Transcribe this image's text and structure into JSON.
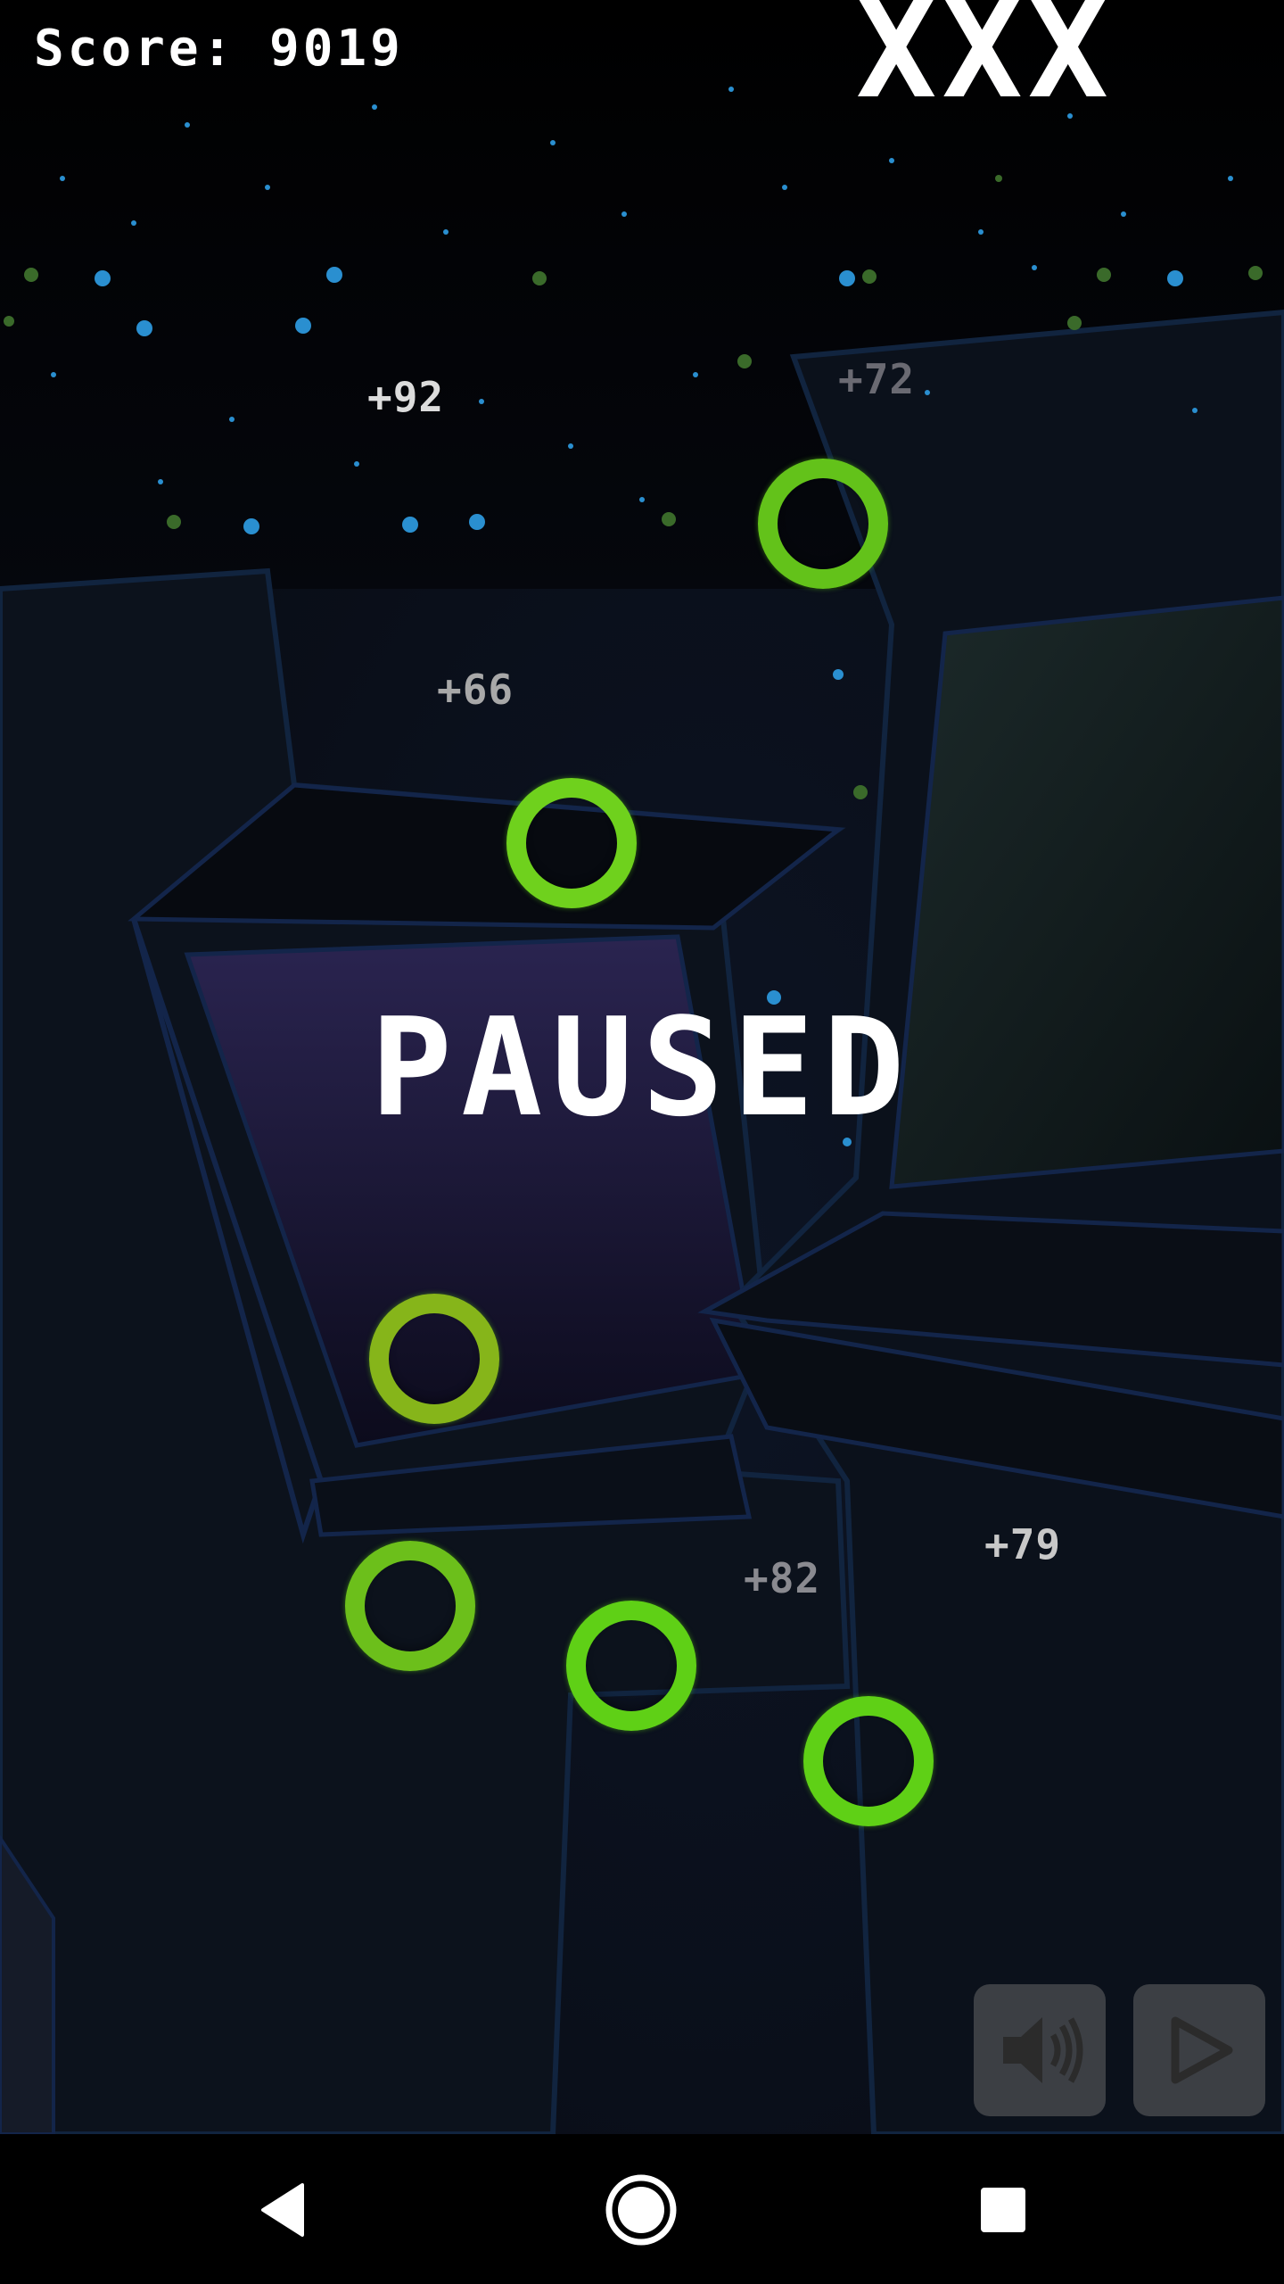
{
  "hud": {
    "score_text": "Score: 9019",
    "lives_text": "XXX"
  },
  "overlay": {
    "paused_text": "PAUSED"
  },
  "floating_points": [
    {
      "text": "+92",
      "color": "#dcdcdc"
    },
    {
      "text": "+72",
      "color": "#6a6a72"
    },
    {
      "text": "+66",
      "color": "#a8a8a8"
    },
    {
      "text": "+82",
      "color": "#8a8a90"
    },
    {
      "text": "+79",
      "color": "#c8c8c8"
    }
  ],
  "targets": [
    {
      "name": "ring-1",
      "color": "#63c21a"
    },
    {
      "name": "ring-2",
      "color": "#6fd11d"
    },
    {
      "name": "ring-3",
      "color": "#86b51a"
    },
    {
      "name": "ring-4",
      "color": "#6cbf1b"
    },
    {
      "name": "ring-5",
      "color": "#5fd016"
    },
    {
      "name": "ring-6",
      "color": "#5fd016"
    }
  ],
  "controls": {
    "sound_icon": "speaker-icon",
    "play_icon": "play-icon"
  },
  "system_nav": {
    "back_icon": "back-triangle-icon",
    "home_icon": "home-circle-icon",
    "recents_icon": "recents-square-icon"
  }
}
